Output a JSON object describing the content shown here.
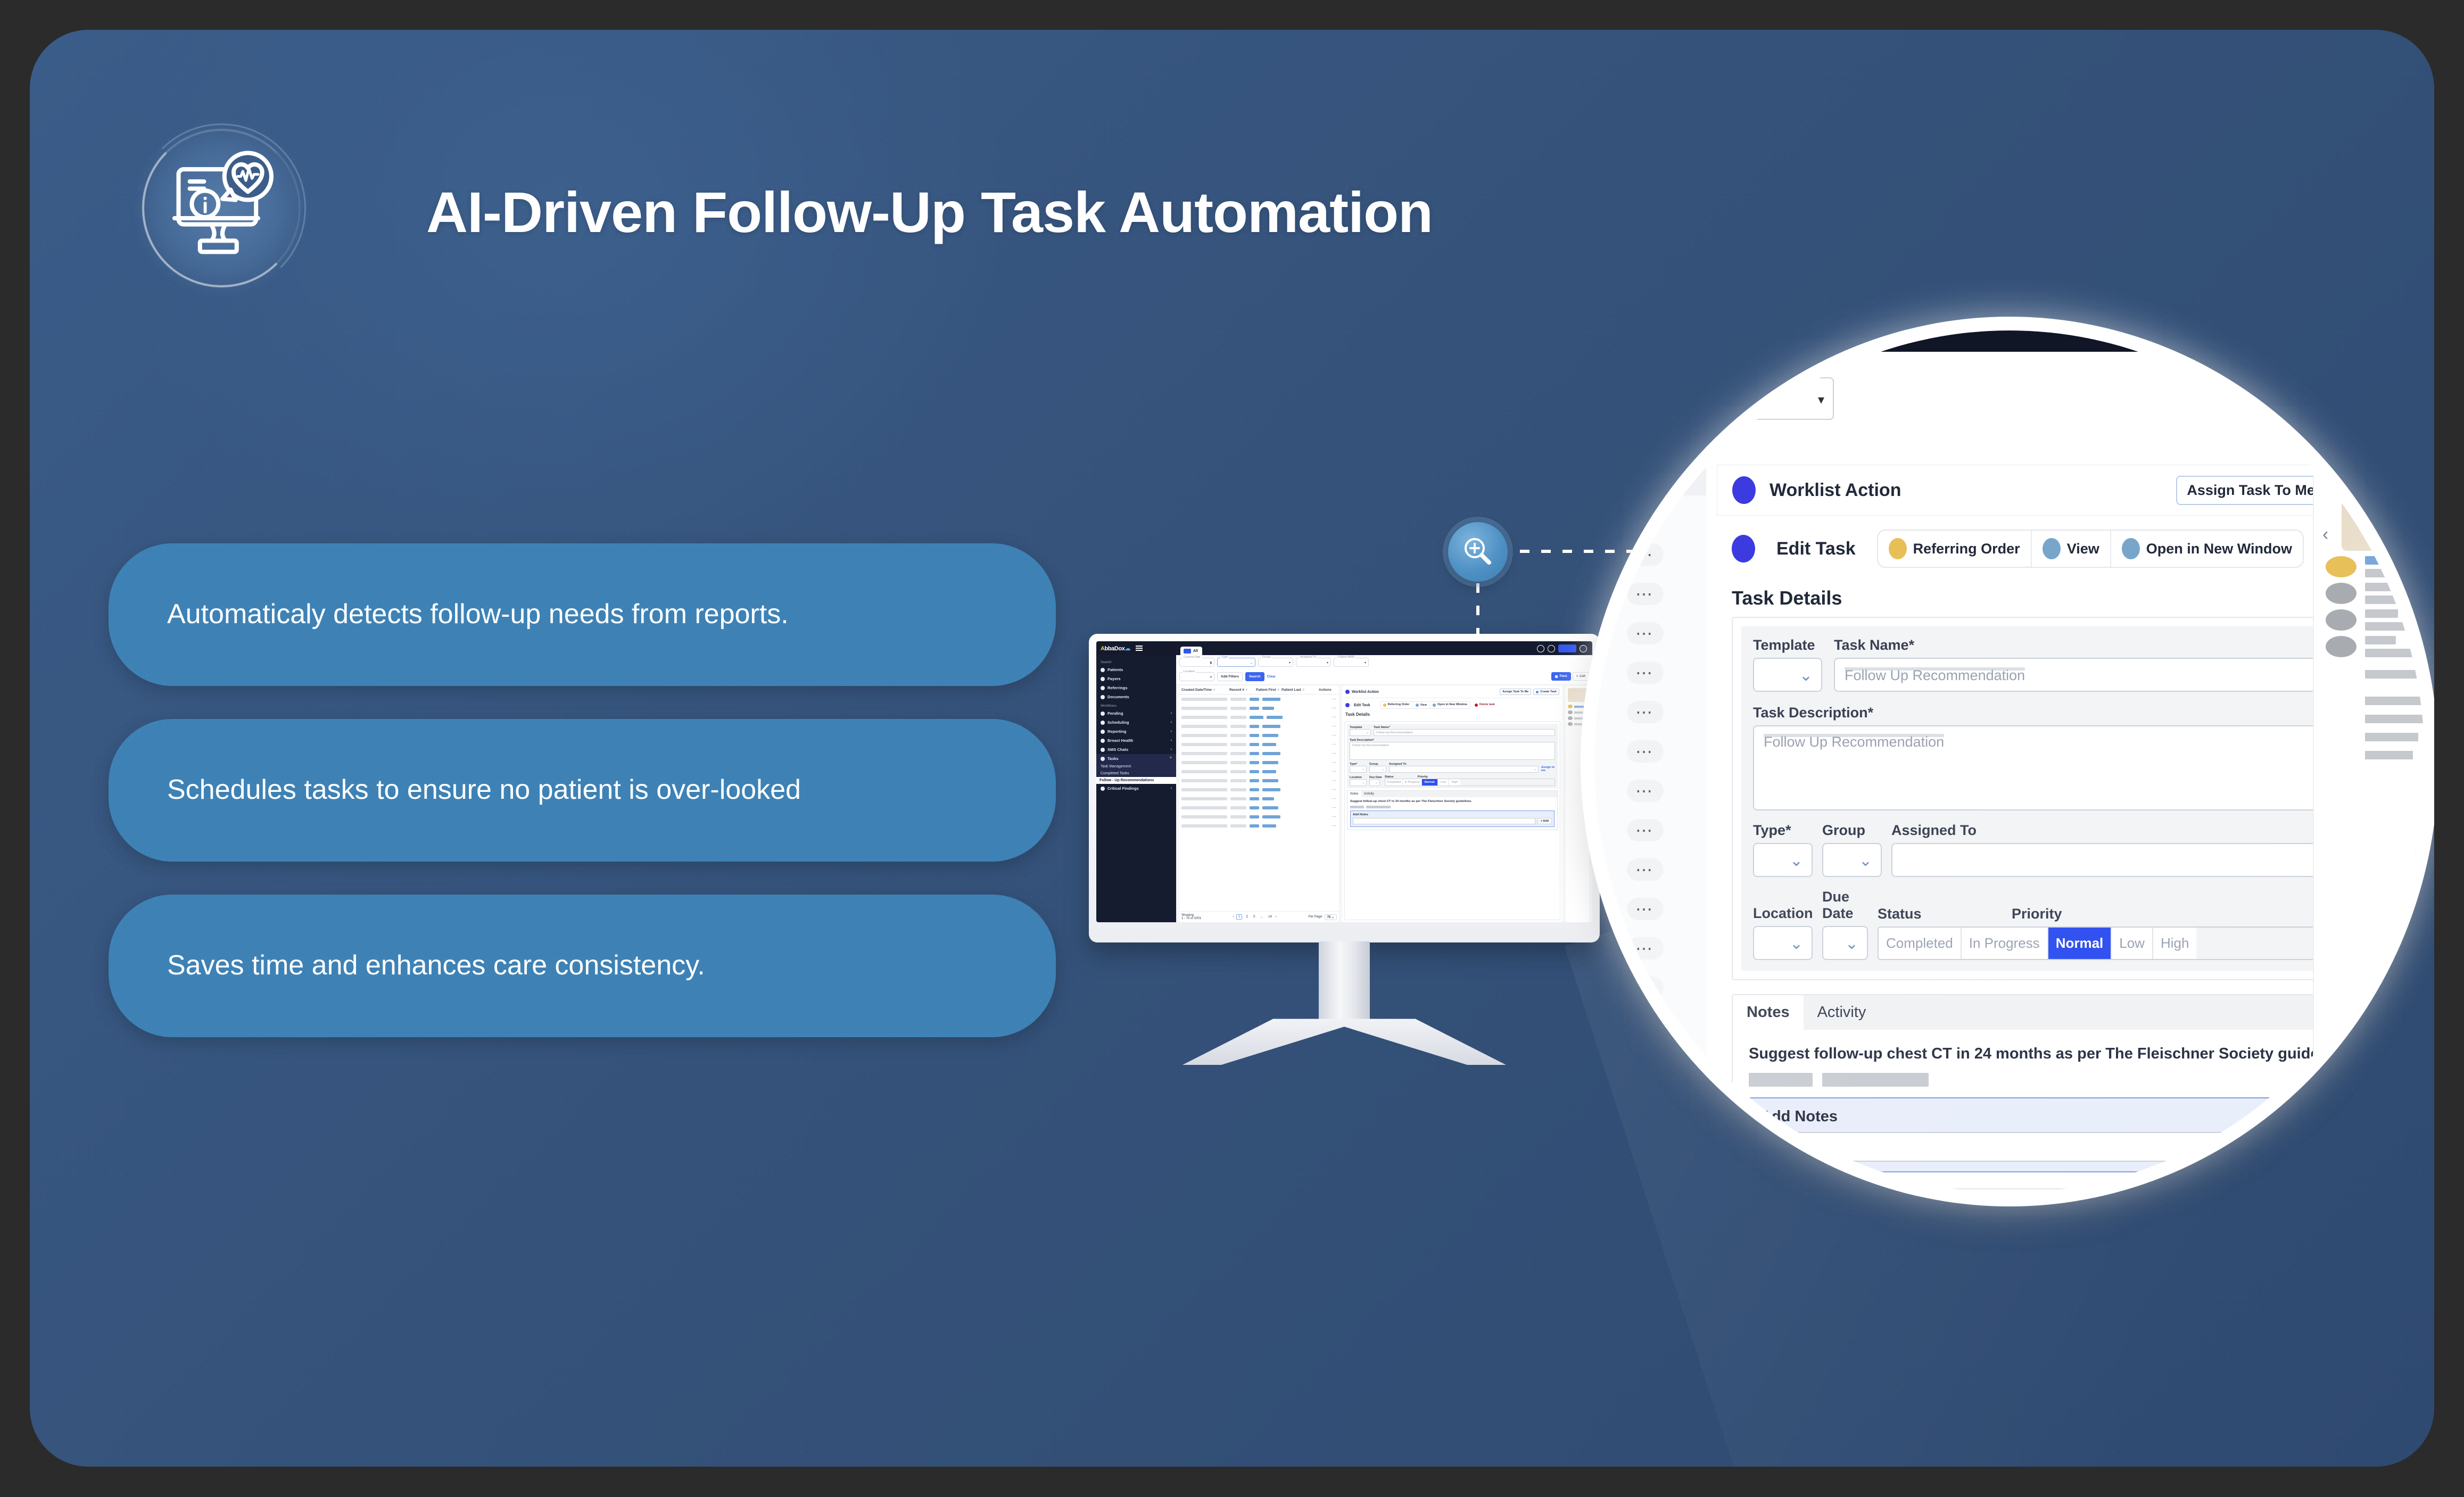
{
  "slide": {
    "title": "AI-Driven Follow-Up Task Automation",
    "logo_icon": "monitor-info-heartbeat-icon",
    "accent_pill": "#3e82b5",
    "background": "#35527a",
    "outer_background": "#2b2b2b"
  },
  "features": [
    {
      "text": "Automaticaly detects follow-up needs from reports."
    },
    {
      "text": "Schedules tasks to ensure no patient is over-looked"
    },
    {
      "text": "Saves time and enhances care consistency."
    }
  ],
  "magnifier": {
    "icon": "zoom-in-magnifier-icon"
  },
  "app": {
    "brand": "AbbaDox",
    "menu_icon": "hamburger-menu-icon",
    "tab_all": "All",
    "view_toggle": {
      "pane": "Pane",
      "list": "List",
      "active": "Pane"
    },
    "sidebar": {
      "groups": [
        {
          "label": "Search",
          "items": [
            {
              "label": "Patients",
              "expandable": false
            },
            {
              "label": "Payers",
              "expandable": false
            },
            {
              "label": "Referrings",
              "expandable": false
            },
            {
              "label": "Documents",
              "expandable": false
            }
          ]
        },
        {
          "label": "Workflows",
          "items": [
            {
              "label": "Pending",
              "expandable": true
            },
            {
              "label": "Scheduling",
              "expandable": true
            },
            {
              "label": "Reporting",
              "expandable": true
            },
            {
              "label": "Breast Health",
              "expandable": true
            },
            {
              "label": "SMS Chats",
              "expandable": true
            },
            {
              "label": "Tasks",
              "expandable": true,
              "active": true
            }
          ]
        }
      ],
      "task_subitems": [
        "Task Management",
        "Completed Tasks"
      ],
      "highlight_item": "Follow - Up Recommendations",
      "last_item": "Critical Findings"
    },
    "filters": {
      "current_date": {
        "label": "Current Date",
        "value": ""
      },
      "type": {
        "label": "Type",
        "value": ""
      },
      "group": {
        "label": "Group",
        "value": ""
      },
      "assigned_to": {
        "label": "Assigned To",
        "value": ""
      },
      "patient_mnr": {
        "label": "Patient MNR",
        "value": ""
      },
      "location": {
        "label": "Location",
        "value": ""
      },
      "add_filters": "Add Filters",
      "search": "Search",
      "clear": "Clear"
    },
    "table": {
      "columns": [
        "Created Date/Time",
        "Record #",
        "Patient First",
        "Patient Last",
        "Actions"
      ],
      "row_action_icon": "ellipsis-icon",
      "showing_label": "Showing",
      "showing_range": "1 - 75 of 1001",
      "pages": [
        "1",
        "2",
        "3",
        "...",
        "14"
      ],
      "current_page": "1",
      "per_page_label": "Per Page:",
      "per_page_value": "75"
    },
    "worklist": {
      "title": "Worklist Action",
      "assign_task_to_me": "Assign Task To Me",
      "create_task": "Create Task"
    },
    "edit_task": {
      "title": "Edit Task",
      "referring_order": "Referring Order",
      "view": "View",
      "open_new_window": "Open in New Window",
      "delete_task": "Delete task"
    },
    "task_details": {
      "heading": "Task Details",
      "template_label": "Template",
      "template_value": "",
      "task_name_label": "Task Name*",
      "task_name_placeholder": "Follow Up Recommendation",
      "task_description_label": "Task Description*",
      "task_description_placeholder": "Follow Up Recommendation",
      "type_label": "Type*",
      "group_label": "Group",
      "assigned_to_label": "Assigned To",
      "assign_to_me": "Assign to me",
      "location_label": "Location",
      "due_date_label": "Due Date",
      "status_label": "Status",
      "priority_label": "Priority",
      "status_options": [
        "Completed",
        "In Progress"
      ],
      "priority_options": [
        "Normal",
        "Low",
        "High"
      ],
      "priority_selected": "Normal"
    },
    "notes": {
      "tabs": [
        "Notes",
        "Activity"
      ],
      "active_tab": "Notes",
      "note_text": "Suggest follow-up chest CT in 24 months as per The Fleischner Society guidelines.",
      "add_notes_label": "Add Notes",
      "add_notes_value": "",
      "add_button": "+ Add"
    }
  }
}
